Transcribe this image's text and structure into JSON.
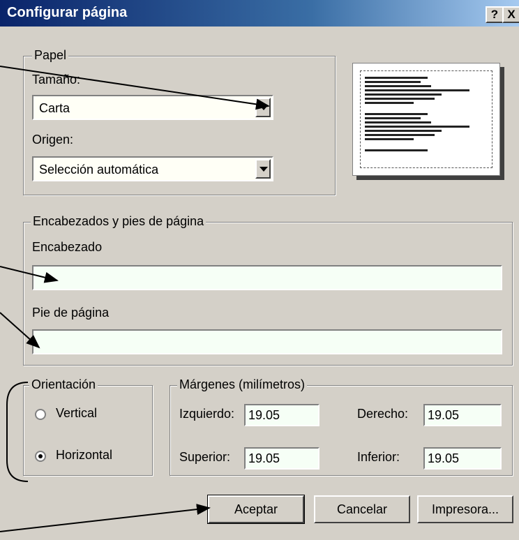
{
  "window": {
    "title": "Configurar página",
    "help_button": "?",
    "close_button": "X"
  },
  "paper": {
    "legend": "Papel",
    "size_label": "Tamaño:",
    "size_value": "Carta",
    "source_label": "Origen:",
    "source_value": "Selección automática"
  },
  "headers": {
    "legend": "Encabezados y pies de página",
    "header_label": "Encabezado",
    "header_value": "",
    "footer_label": "Pie de página",
    "footer_value": ""
  },
  "orientation": {
    "legend": "Orientación",
    "options": [
      {
        "label": "Vertical",
        "selected": false
      },
      {
        "label": "Horizontal",
        "selected": true
      }
    ]
  },
  "margins": {
    "legend": "Márgenes (milímetros)",
    "left_label": "Izquierdo:",
    "left_value": "19.05",
    "right_label": "Derecho:",
    "right_value": "19.05",
    "top_label": "Superior:",
    "top_value": "19.05",
    "bottom_label": "Inferior:",
    "bottom_value": "19.05"
  },
  "buttons": {
    "ok": "Aceptar",
    "cancel": "Cancelar",
    "printer": "Impresora..."
  },
  "colors": {
    "title_bar": "#0a246a",
    "face": "#d4d0c8"
  }
}
